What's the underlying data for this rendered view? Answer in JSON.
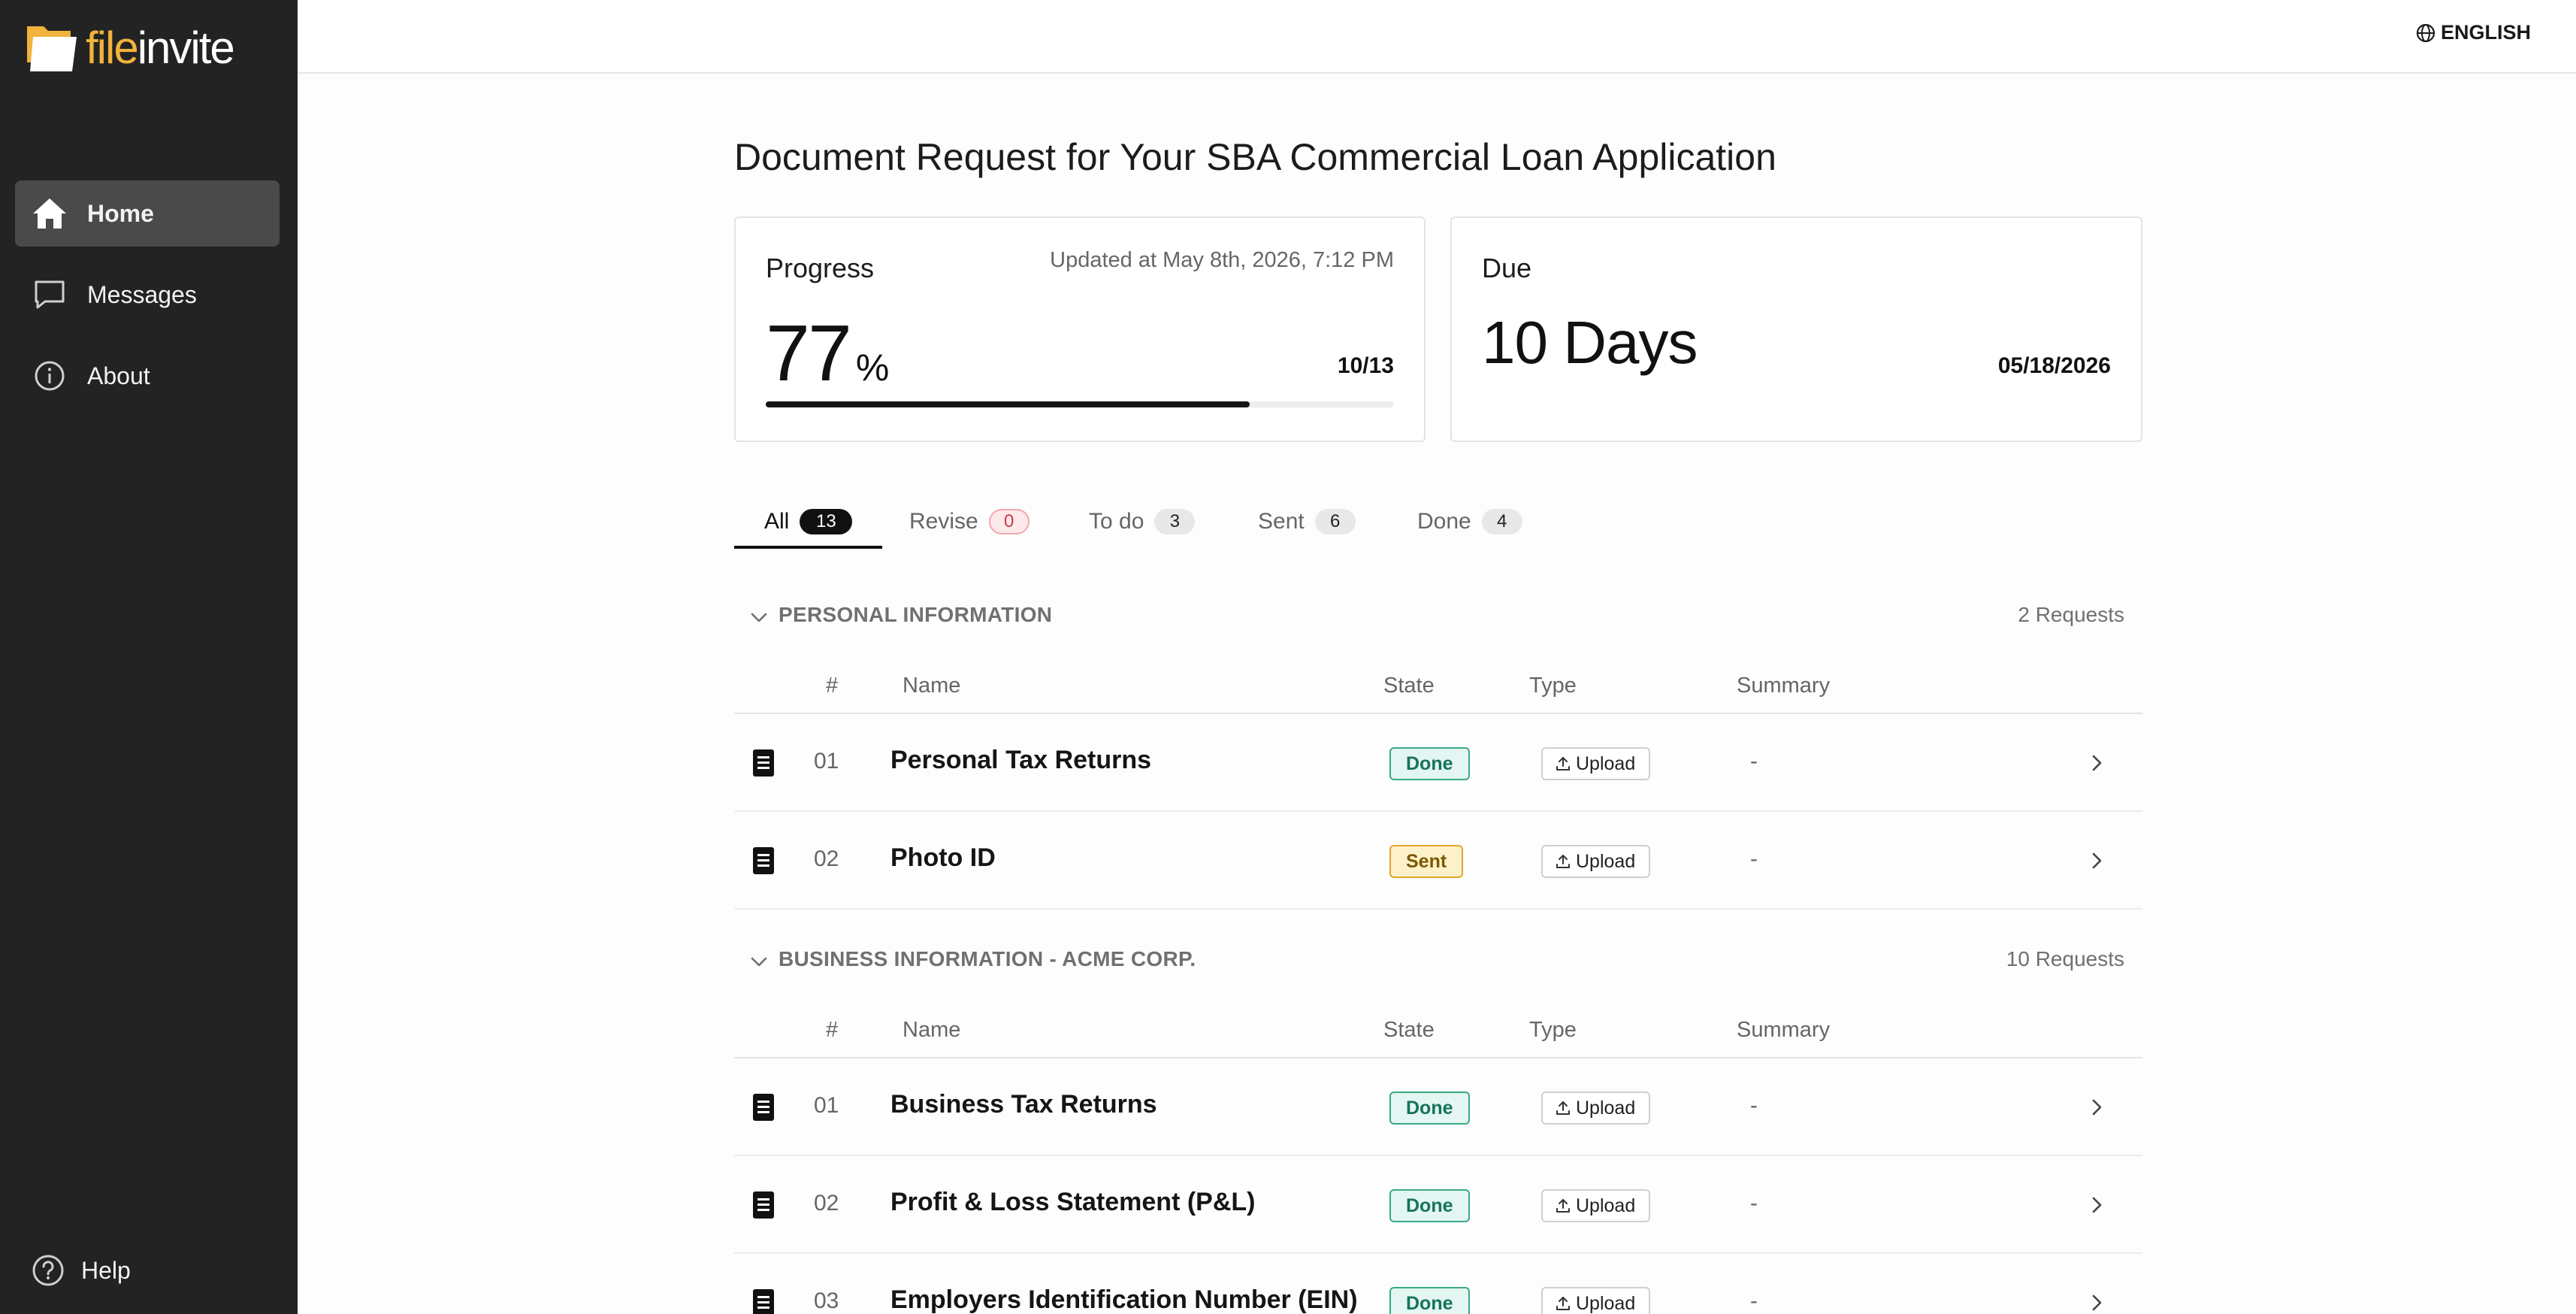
{
  "brand": {
    "file": "file",
    "invite": "invite",
    "accent": "#f1b33c",
    "icon": "folder-logo-icon"
  },
  "sidebar": {
    "items": [
      {
        "label": "Home",
        "icon": "home-icon",
        "active": true
      },
      {
        "label": "Messages",
        "icon": "message-icon",
        "active": false
      },
      {
        "label": "About",
        "icon": "info-icon",
        "active": false
      }
    ],
    "help": "Help"
  },
  "topbar": {
    "language": "ENGLISH"
  },
  "page": {
    "title": "Document Request for Your SBA Commercial Loan Application"
  },
  "progress": {
    "label": "Progress",
    "updated": "Updated at May 8th, 2026, 7:12 PM",
    "percent": "77",
    "percent_sign": "%",
    "fraction": "10/13",
    "fill_percent": 77
  },
  "due": {
    "label": "Due",
    "days": "10 Days",
    "date": "05/18/2026"
  },
  "tabs": [
    {
      "label": "All",
      "count": "13",
      "active": true
    },
    {
      "label": "Revise",
      "count": "0",
      "active": false
    },
    {
      "label": "To do",
      "count": "3",
      "active": false
    },
    {
      "label": "Sent",
      "count": "6",
      "active": false
    },
    {
      "label": "Done",
      "count": "4",
      "active": false
    }
  ],
  "columns": {
    "num": "#",
    "name": "Name",
    "state": "State",
    "type": "Type",
    "summary": "Summary"
  },
  "sections": [
    {
      "title": "PERSONAL INFORMATION",
      "count": "2 Requests",
      "rows": [
        {
          "num": "01",
          "name": "Personal Tax Returns",
          "state": "Done",
          "type": "Upload",
          "summary": "-"
        },
        {
          "num": "02",
          "name": "Photo ID",
          "state": "Sent",
          "type": "Upload",
          "summary": "-"
        }
      ]
    },
    {
      "title": "BUSINESS INFORMATION - ACME CORP.",
      "count": "10 Requests",
      "rows": [
        {
          "num": "01",
          "name": "Business Tax Returns",
          "state": "Done",
          "type": "Upload",
          "summary": "-"
        },
        {
          "num": "02",
          "name": "Profit & Loss Statement (P&L)",
          "state": "Done",
          "type": "Upload",
          "summary": "-"
        },
        {
          "num": "03",
          "name": "Employers Identification Number (EIN)",
          "state": "Done",
          "type": "Upload",
          "summary": "-"
        }
      ]
    }
  ]
}
